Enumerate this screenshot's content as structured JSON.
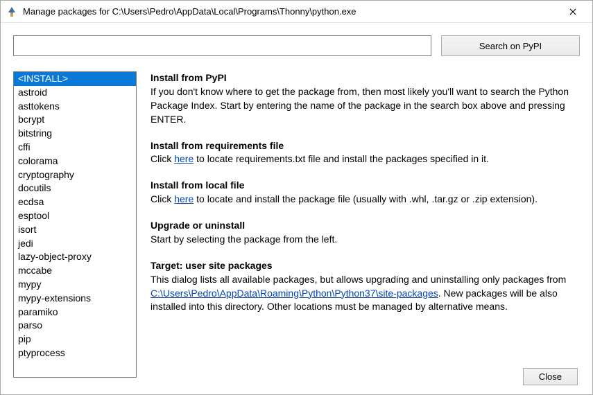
{
  "window": {
    "title": "Manage packages for C:\\Users\\Pedro\\AppData\\Local\\Programs\\Thonny\\python.exe"
  },
  "search": {
    "value": "",
    "placeholder": "",
    "button_label": "Search on PyPI"
  },
  "packages": {
    "selected_index": 0,
    "items": [
      "<INSTALL>",
      "astroid",
      "asttokens",
      "bcrypt",
      "bitstring",
      "cffi",
      "colorama",
      "cryptography",
      "docutils",
      "ecdsa",
      "esptool",
      "isort",
      "jedi",
      "lazy-object-proxy",
      "mccabe",
      "mypy",
      "mypy-extensions",
      "paramiko",
      "parso",
      "pip",
      "ptyprocess"
    ]
  },
  "details": {
    "s1": {
      "heading": "Install from PyPI",
      "body": "If you don't know where to get the package from, then most likely you'll want to search the Python Package Index. Start by entering the name of the package in the search box above and pressing ENTER."
    },
    "s2": {
      "heading": "Install from requirements file",
      "pre": "Click ",
      "link": "here",
      "post": " to locate requirements.txt file and install the packages specified in it."
    },
    "s3": {
      "heading": "Install from local file",
      "pre": "Click ",
      "link": "here",
      "post": " to locate and install the package file (usually with .whl, .tar.gz or .zip extension)."
    },
    "s4": {
      "heading": "Upgrade or uninstall",
      "body": "Start by selecting the package from the left."
    },
    "s5": {
      "heading": "Target:  user site packages",
      "pre": "This dialog lists all available packages, but allows upgrading and uninstalling only packages from ",
      "link": "C:\\Users\\Pedro\\AppData\\Roaming\\Python\\Python37\\site-packages",
      "post": ". New packages will be also installed into this directory. Other locations must be managed by alternative means."
    }
  },
  "footer": {
    "close_label": "Close"
  }
}
